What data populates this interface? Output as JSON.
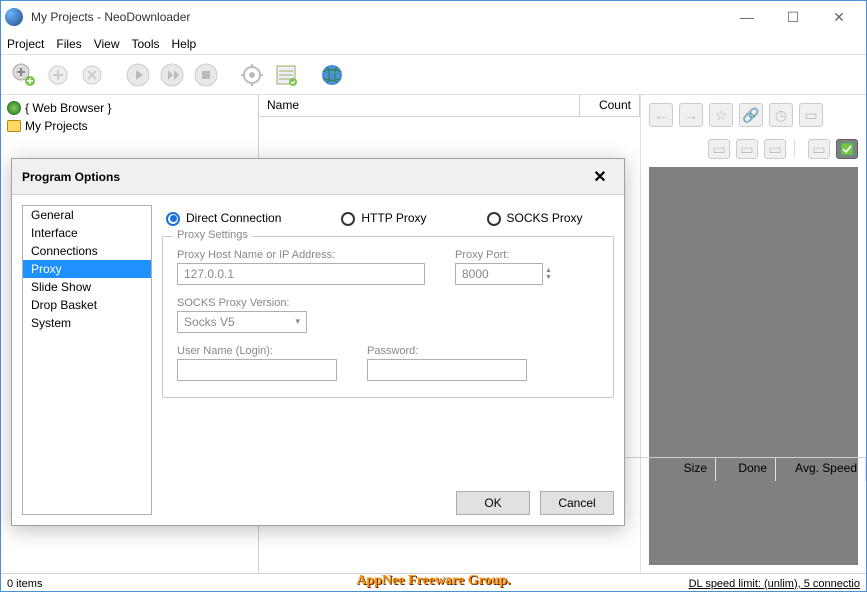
{
  "window": {
    "title": "My Projects - NeoDownloader"
  },
  "menubar": [
    "Project",
    "Files",
    "View",
    "Tools",
    "Help"
  ],
  "tree": {
    "web_browser": "{ Web Browser }",
    "my_projects": "My Projects"
  },
  "list_headers": {
    "name": "Name",
    "count": "Count"
  },
  "lower_headers": {
    "size": "Size",
    "done": "Done",
    "avg": "Avg. Speed"
  },
  "status": {
    "items": "0 items",
    "dl": "DL speed limit: (unlim), 5 connectio"
  },
  "watermark": "AppNee Freeware Group.",
  "dialog": {
    "title": "Program Options",
    "nav": [
      "General",
      "Interface",
      "Connections",
      "Proxy",
      "Slide Show",
      "Drop Basket",
      "System"
    ],
    "nav_selected": 3,
    "radio": {
      "direct": "Direct Connection",
      "http": "HTTP Proxy",
      "socks": "SOCKS Proxy"
    },
    "legend": "Proxy Settings",
    "fields": {
      "host_label": "Proxy Host Name or IP Address:",
      "host_value": "127.0.0.1",
      "port_label": "Proxy Port:",
      "port_value": "8000",
      "socksver_label": "SOCKS Proxy Version:",
      "socksver_value": "Socks V5",
      "user_label": "User Name (Login):",
      "user_value": "",
      "pass_label": "Password:",
      "pass_value": ""
    },
    "buttons": {
      "ok": "OK",
      "cancel": "Cancel"
    }
  }
}
